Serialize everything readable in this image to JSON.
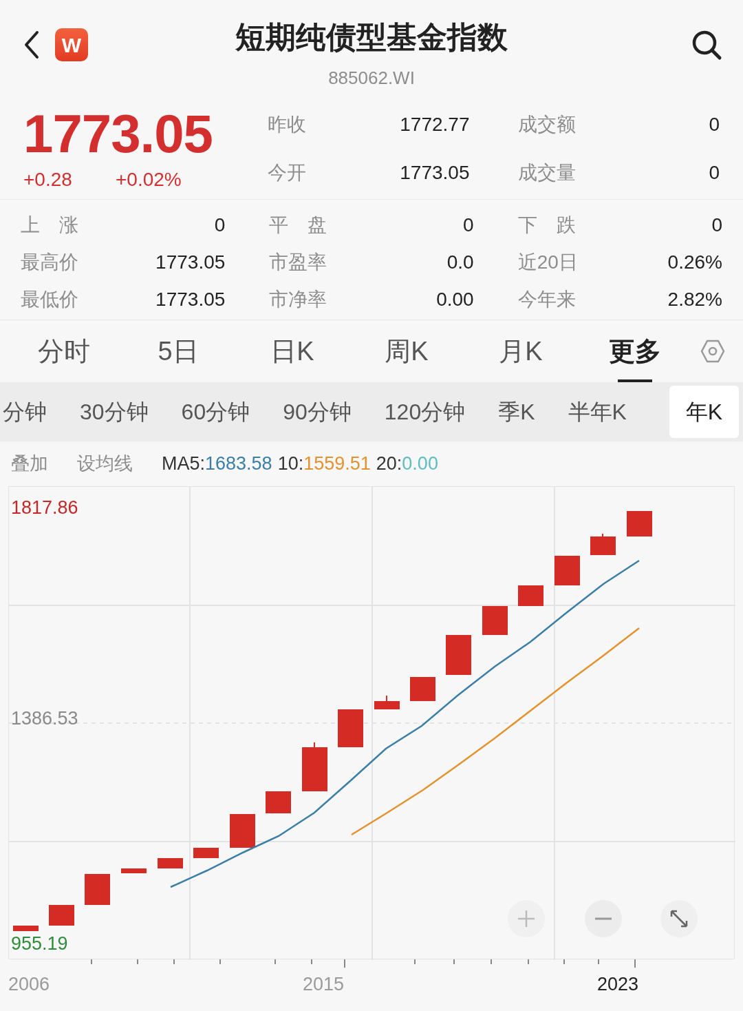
{
  "header": {
    "title": "短期纯债型基金指数",
    "code": "885062.WI",
    "logo": "W"
  },
  "quote": {
    "price": "1773.05",
    "change": "+0.28",
    "change_pct": "+0.02%",
    "fields": [
      {
        "label": "昨收",
        "value": "1772.77"
      },
      {
        "label": "成交额",
        "value": "0"
      },
      {
        "label": "今开",
        "value": "1773.05"
      },
      {
        "label": "成交量",
        "value": "0"
      }
    ]
  },
  "stats": [
    {
      "label": "上　涨",
      "value": "0"
    },
    {
      "label": "平　盘",
      "value": "0"
    },
    {
      "label": "下　跌",
      "value": "0"
    },
    {
      "label": "最高价",
      "value": "1773.05"
    },
    {
      "label": "市盈率",
      "value": "0.0"
    },
    {
      "label": "近20日",
      "value": "0.26%"
    },
    {
      "label": "最低价",
      "value": "1773.05"
    },
    {
      "label": "市净率",
      "value": "0.00"
    },
    {
      "label": "今年来",
      "value": "2.82%"
    }
  ],
  "tabs": [
    {
      "label": "分时",
      "selected": false
    },
    {
      "label": "5日",
      "selected": false
    },
    {
      "label": "日K",
      "selected": false
    },
    {
      "label": "周K",
      "selected": false
    },
    {
      "label": "月K",
      "selected": false
    },
    {
      "label": "更多",
      "selected": true
    }
  ],
  "sub_tabs": [
    {
      "label": "分钟",
      "selected": false
    },
    {
      "label": "30分钟",
      "selected": false
    },
    {
      "label": "60分钟",
      "selected": false
    },
    {
      "label": "90分钟",
      "selected": false
    },
    {
      "label": "120分钟",
      "selected": false
    },
    {
      "label": "季K",
      "selected": false
    },
    {
      "label": "半年K",
      "selected": false
    },
    {
      "label": "年K",
      "selected": true
    }
  ],
  "toolbar": [
    "叠加",
    "设均线"
  ],
  "ma_lines": [
    {
      "label": "MA5:",
      "value": "1683.58",
      "color": "#3b7fa6"
    },
    {
      "label": "10:",
      "value": "1559.51",
      "color": "#e3922e"
    },
    {
      "label": "20:",
      "value": "0.00",
      "color": "#5dbdbf"
    }
  ],
  "chart": {
    "y_labels": [
      {
        "text": "1817.86",
        "kind": "high"
      },
      {
        "text": "1386.53",
        "kind": "mid"
      },
      {
        "text": "955.19",
        "kind": "low"
      }
    ],
    "x_labels": [
      {
        "text": "2006",
        "highlighted": false
      },
      {
        "text": "2015",
        "highlighted": false
      },
      {
        "text": "2023",
        "highlighted": true
      }
    ]
  }
}
